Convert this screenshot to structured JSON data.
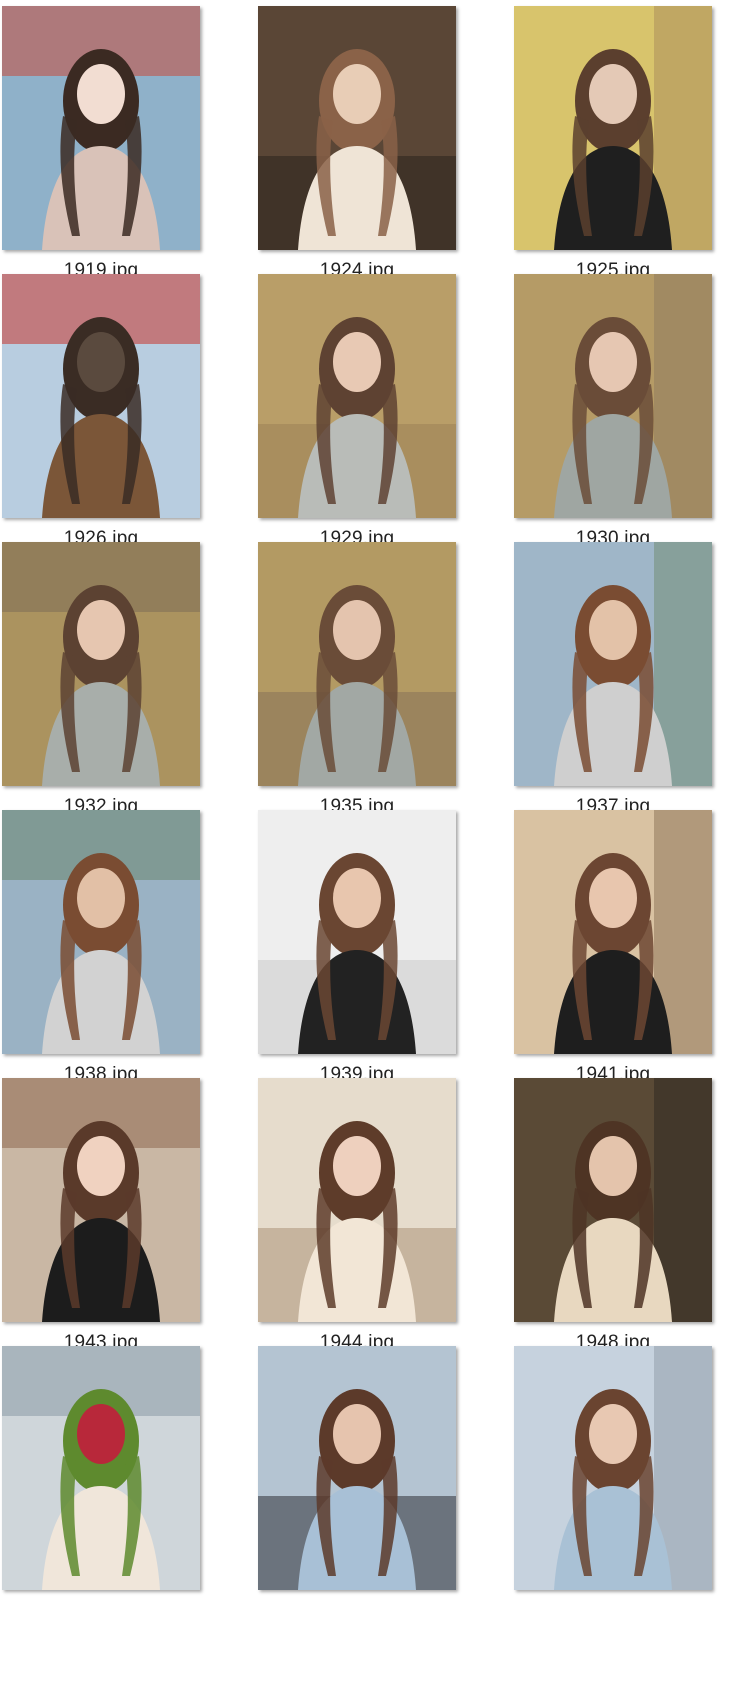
{
  "files": [
    {
      "name": "1919.jpg",
      "icon": "photo-thumbnail-icon",
      "palette": [
        "#8fb1c9",
        "#c94a3a",
        "#f2ddd2",
        "#3b2a22",
        "#d9c2b8"
      ]
    },
    {
      "name": "1924.jpg",
      "icon": "photo-thumbnail-icon",
      "palette": [
        "#5a4636",
        "#2e2620",
        "#e8cdb6",
        "#8a6248",
        "#efe4d6"
      ]
    },
    {
      "name": "1925.jpg",
      "icon": "photo-thumbnail-icon",
      "palette": [
        "#d8c46c",
        "#a88a5a",
        "#e4c9b6",
        "#5b3f2e",
        "#1f1f1f"
      ]
    },
    {
      "name": "1926.jpg",
      "icon": "photo-thumbnail-icon",
      "palette": [
        "#b8cde0",
        "#c8362d",
        "#5a4a3e",
        "#3a2c24",
        "#7b5638"
      ]
    },
    {
      "name": "1929.jpg",
      "icon": "photo-thumbnail-icon",
      "palette": [
        "#b99e68",
        "#9e8458",
        "#e8c9b4",
        "#5e4232",
        "#b9bcb8"
      ]
    },
    {
      "name": "1930.jpg",
      "icon": "photo-thumbnail-icon",
      "palette": [
        "#b59b66",
        "#8e7a5e",
        "#e6c7b2",
        "#6a4c38",
        "#9fa6a2"
      ]
    },
    {
      "name": "1932.jpg",
      "icon": "photo-thumbnail-icon",
      "palette": [
        "#ab935f",
        "#7e6d56",
        "#e6c6b0",
        "#5c4232",
        "#a8aeaa"
      ]
    },
    {
      "name": "1935.jpg",
      "icon": "photo-thumbnail-icon",
      "palette": [
        "#b39a63",
        "#8a765a",
        "#e4c4ae",
        "#6a4c38",
        "#a2a8a4"
      ]
    },
    {
      "name": "1937.jpg",
      "icon": "photo-thumbnail-icon",
      "palette": [
        "#9fb6c8",
        "#6f8a6e",
        "#e3c2a8",
        "#7a4c32",
        "#cfcfcf"
      ]
    },
    {
      "name": "1938.jpg",
      "icon": "photo-thumbnail-icon",
      "palette": [
        "#9ab2c4",
        "#6b8770",
        "#e2c0a6",
        "#7a4c32",
        "#d2d2d2"
      ]
    },
    {
      "name": "1939.jpg",
      "icon": "photo-thumbnail-icon",
      "palette": [
        "#eeeeee",
        "#cfcfcf",
        "#e8c6ae",
        "#6a4632",
        "#222222"
      ]
    },
    {
      "name": "1941.jpg",
      "icon": "photo-thumbnail-icon",
      "palette": [
        "#d9c2a2",
        "#8a7054",
        "#e8c6ae",
        "#6c4632",
        "#1e1e1e"
      ]
    },
    {
      "name": "1943.jpg",
      "icon": "photo-thumbnail-icon",
      "palette": [
        "#c9b7a4",
        "#8e6a50",
        "#f0d2c0",
        "#5a3a2a",
        "#1c1c1c"
      ]
    },
    {
      "name": "1944.jpg",
      "icon": "photo-thumbnail-icon",
      "palette": [
        "#e6dccc",
        "#b09a7e",
        "#eed0be",
        "#5e3c2a",
        "#f2e6d6"
      ]
    },
    {
      "name": "1948.jpg",
      "icon": "photo-thumbnail-icon",
      "palette": [
        "#5a4a36",
        "#2c2620",
        "#e4c4ac",
        "#4e3424",
        "#e8d8c0"
      ]
    },
    {
      "name": "",
      "icon": "photo-thumbnail-icon",
      "palette": [
        "#cfd6da",
        "#8a9aa6",
        "#b8283a",
        "#5e8a2e",
        "#f0e6da"
      ]
    },
    {
      "name": "",
      "icon": "photo-thumbnail-icon",
      "palette": [
        "#b4c4d2",
        "#3a3e44",
        "#e6c4ae",
        "#5c3a2a",
        "#a8c0d6"
      ]
    },
    {
      "name": "",
      "icon": "photo-thumbnail-icon",
      "palette": [
        "#c6d2de",
        "#8e9aa6",
        "#e8c8b2",
        "#6a4430",
        "#a9c1d5"
      ]
    }
  ]
}
